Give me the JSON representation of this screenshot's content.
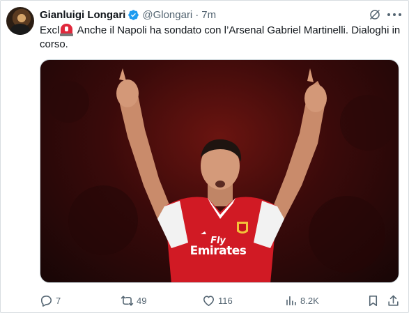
{
  "author": {
    "name": "Gianluigi Longari",
    "handle": "@Glongari",
    "time": "7m",
    "verified_color": "#1d9bf0"
  },
  "tweet": {
    "text_before_emoji": "Excl",
    "emoji": "police-car-light-emoji",
    "text_after_emoji": " Anche il Napoli ha sondato con l’Arsenal Gabriel Martinelli. Dialoghi in corso."
  },
  "media": {
    "shirt_line1": "Fly",
    "shirt_line2": "Emirates"
  },
  "actions": {
    "replies": "7",
    "retweets": "49",
    "likes": "116",
    "views": "8.2K"
  },
  "icons": {
    "grok": "grok-icon",
    "more": "more-icon",
    "reply": "reply-icon",
    "retweet": "retweet-icon",
    "like": "heart-icon",
    "views": "views-chart-icon",
    "bookmark": "bookmark-icon",
    "share": "share-icon"
  },
  "colors": {
    "text": "#0f1419",
    "secondary": "#536471",
    "accent": "#1d9bf0"
  }
}
